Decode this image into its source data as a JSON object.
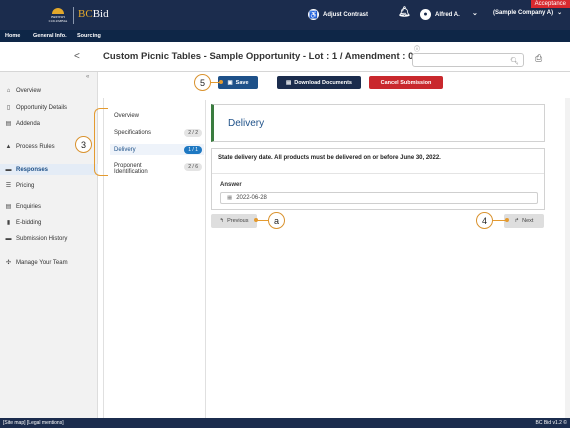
{
  "brand": {
    "logo_text": "BRITISH COLUMBIA",
    "prefix": "BC",
    "suffix": "Bid"
  },
  "topbar": {
    "adjust_contrast": "Adjust Contrast",
    "user": "Alfred A.",
    "company": "(Sample Company A)",
    "environment_badge": "Acceptance"
  },
  "navbar": {
    "items": [
      "Home",
      "General Info.",
      "Sourcing"
    ]
  },
  "header": {
    "back_glyph": "<",
    "title": "Custom Picnic Tables - Sample Opportunity - Lot : 1 / Amendment : 0",
    "info_glyph": "ⓘ",
    "search_placeholder": ""
  },
  "sidebar": {
    "collapse_glyph": "«",
    "items": [
      {
        "label": "Overview",
        "icon": "home-icon"
      },
      {
        "label": "Opportunity Details",
        "icon": "document-icon"
      },
      {
        "label": "Addenda",
        "icon": "list-icon"
      },
      {
        "label": "Process Rules",
        "icon": "warning-icon"
      },
      {
        "label": "Responses",
        "icon": "folder-icon",
        "active": true
      },
      {
        "label": "Pricing",
        "icon": "list-icon"
      },
      {
        "label": "Enquiries",
        "icon": "message-icon"
      },
      {
        "label": "E-bidding",
        "icon": "gavel-icon"
      },
      {
        "label": "Submission History",
        "icon": "history-icon"
      },
      {
        "label": "Manage Your Team",
        "icon": "team-icon"
      }
    ]
  },
  "actions": {
    "save": "Save",
    "download": "Download Documents",
    "cancel": "Cancel Submission"
  },
  "sections": {
    "items": [
      {
        "label": "Overview",
        "count": ""
      },
      {
        "label": "Specifications",
        "count": "2 / 2"
      },
      {
        "label": "Delivery",
        "count": "1 / 1",
        "active": true
      },
      {
        "label": "Proponent Identification",
        "count": "2 / 6"
      }
    ]
  },
  "content": {
    "section_title": "Delivery",
    "question": "State delivery date. All products must be delivered on or before June 30, 2022.",
    "answer_label": "Answer",
    "answer_value": "2022-06-28",
    "previous": "Previous",
    "next": "Next"
  },
  "annotations": {
    "save_marker": "5",
    "sections_marker": "3",
    "previous_marker": "a",
    "next_marker": "4"
  },
  "footer": {
    "links": "[Site map] [Legal mentions]",
    "version": "BC Bid v1.2 ©"
  },
  "colors": {
    "topbar": "#1b2c4d",
    "primary": "#1e5189",
    "danger": "#c9282d",
    "accent_green": "#3a7c3f",
    "annotation": "#e49a2f"
  }
}
